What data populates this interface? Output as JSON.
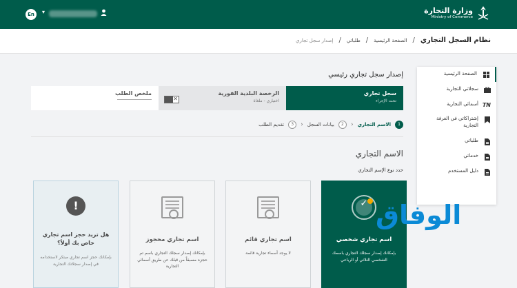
{
  "topbar": {
    "lang_label": "En",
    "user_caret": "▾",
    "user_icon": "user-icon",
    "logo_ar": "وزارة التجارة",
    "logo_en": "Ministry of Commerce",
    "bg_color": "#005c4b"
  },
  "header": {
    "system_title": "نظام السجل التجاري",
    "breadcrumb": [
      "الصفحة الرئيسية",
      "طلباتي",
      "إصدار سجل تجاري"
    ]
  },
  "sidebar": {
    "items": [
      {
        "label": "الصفحة الرئيسية",
        "icon": "grid-icon"
      },
      {
        "label": "سجلاتي التجارية",
        "icon": "briefcase-icon"
      },
      {
        "label": "أسمائي التجارية",
        "icon": "tn-icon"
      },
      {
        "label": "إشتراكاتي في الغرفة التجارية",
        "icon": "bookmark-icon"
      },
      {
        "label": "طلباتي",
        "icon": "document-icon"
      },
      {
        "label": "خدماتي",
        "icon": "document-icon"
      },
      {
        "label": "دليل المستخدم",
        "icon": "document-icon"
      }
    ]
  },
  "main": {
    "title": "إصدار سجل تجاري رئيسي",
    "tabs": [
      {
        "label": "سجل تجاري",
        "sub": "تحت الإجراء"
      },
      {
        "label": "الرخصة البلدية الفورية",
        "sub": "اختياري - ملغاة"
      },
      {
        "label": "ملخص الطلب",
        "sub": ""
      }
    ],
    "steps": [
      {
        "num": "1",
        "label": "الاسم التجاري"
      },
      {
        "num": "2",
        "label": "بيانات السجل"
      },
      {
        "num": "3",
        "label": "تقديم الطلب"
      }
    ],
    "section_title": "الاسم التجاري",
    "section_sub": "حدد نوع الإسم التجاري",
    "cards": [
      {
        "title": "اسم تجاري شخصي",
        "desc": "بإمكانك إصدار سجلك التجاري باسمك الشخصي الثلاثي أو الرباعي"
      },
      {
        "title": "اسم تجاري قائم",
        "desc": "لا يوجد أسماء تجارية قائمة"
      },
      {
        "title": "اسم تجاري محجوز",
        "desc": "بإمكانك إصدار سجلك التجاري باسم تم حجزه مسبقاً من قبلك عن طريق أسمائي التجارية"
      },
      {
        "title": "هل تريد حجز اسم تجاري خاص بك أولاً؟",
        "desc": "بإمكانك حجز اسم تجاري مبتكر لاستخدامه في إصدار سجلاتك التجارية"
      }
    ]
  },
  "watermark": "الوفاق"
}
